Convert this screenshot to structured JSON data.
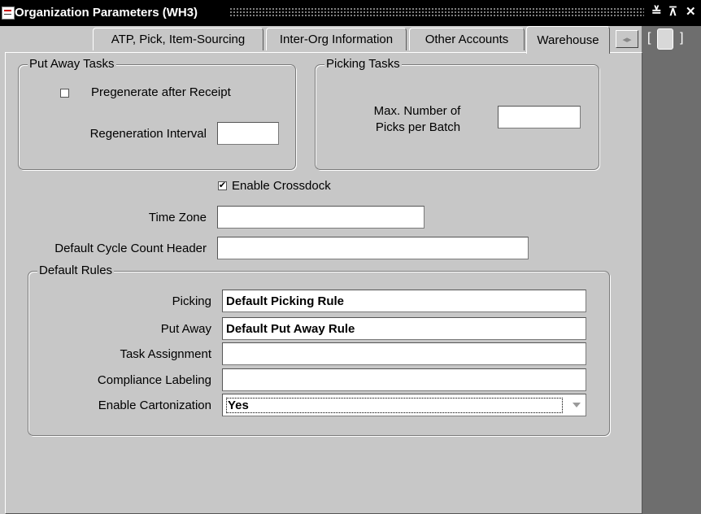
{
  "window": {
    "title": "Organization Parameters (WH3)",
    "controls": {
      "minimize": "≚",
      "maximize": "⊼",
      "close": "✕"
    }
  },
  "tabs": [
    {
      "label": "ATP, Pick, Item-Sourcing",
      "active": false
    },
    {
      "label": "Inter-Org Information",
      "active": false
    },
    {
      "label": "Other Accounts",
      "active": false
    },
    {
      "label": "Warehouse",
      "active": true
    }
  ],
  "tab_scroll": {
    "arrows": "◂▸",
    "bracket_left": "[",
    "bracket_right": "]"
  },
  "put_away_tasks": {
    "legend": "Put Away Tasks",
    "pregenerate_label": "Pregenerate after Receipt",
    "pregenerate_checked": false,
    "regeneration_interval_label": "Regeneration Interval",
    "regeneration_interval_value": ""
  },
  "picking_tasks": {
    "legend": "Picking Tasks",
    "max_picks_label_line1": "Max. Number of",
    "max_picks_label_line2": "Picks per Batch",
    "max_picks_value": ""
  },
  "crossdock": {
    "label": "Enable Crossdock",
    "checked": true,
    "check_glyph": "✔"
  },
  "time_zone": {
    "label": "Time Zone",
    "value": ""
  },
  "cycle_count": {
    "label": "Default Cycle Count Header",
    "value": ""
  },
  "default_rules": {
    "legend": "Default Rules",
    "picking": {
      "label": "Picking",
      "value": "Default Picking Rule"
    },
    "put_away": {
      "label": "Put Away",
      "value": "Default Put Away Rule"
    },
    "task_assignment": {
      "label": "Task Assignment",
      "value": ""
    },
    "compliance_labeling": {
      "label": "Compliance Labeling",
      "value": ""
    },
    "enable_cartonization": {
      "label": "Enable Cartonization",
      "value": "Yes"
    }
  },
  "colors": {
    "background": "#c7c7c7",
    "titlebar": "#000000",
    "stripe": "#6e6e6e",
    "field": "#ffffff"
  }
}
